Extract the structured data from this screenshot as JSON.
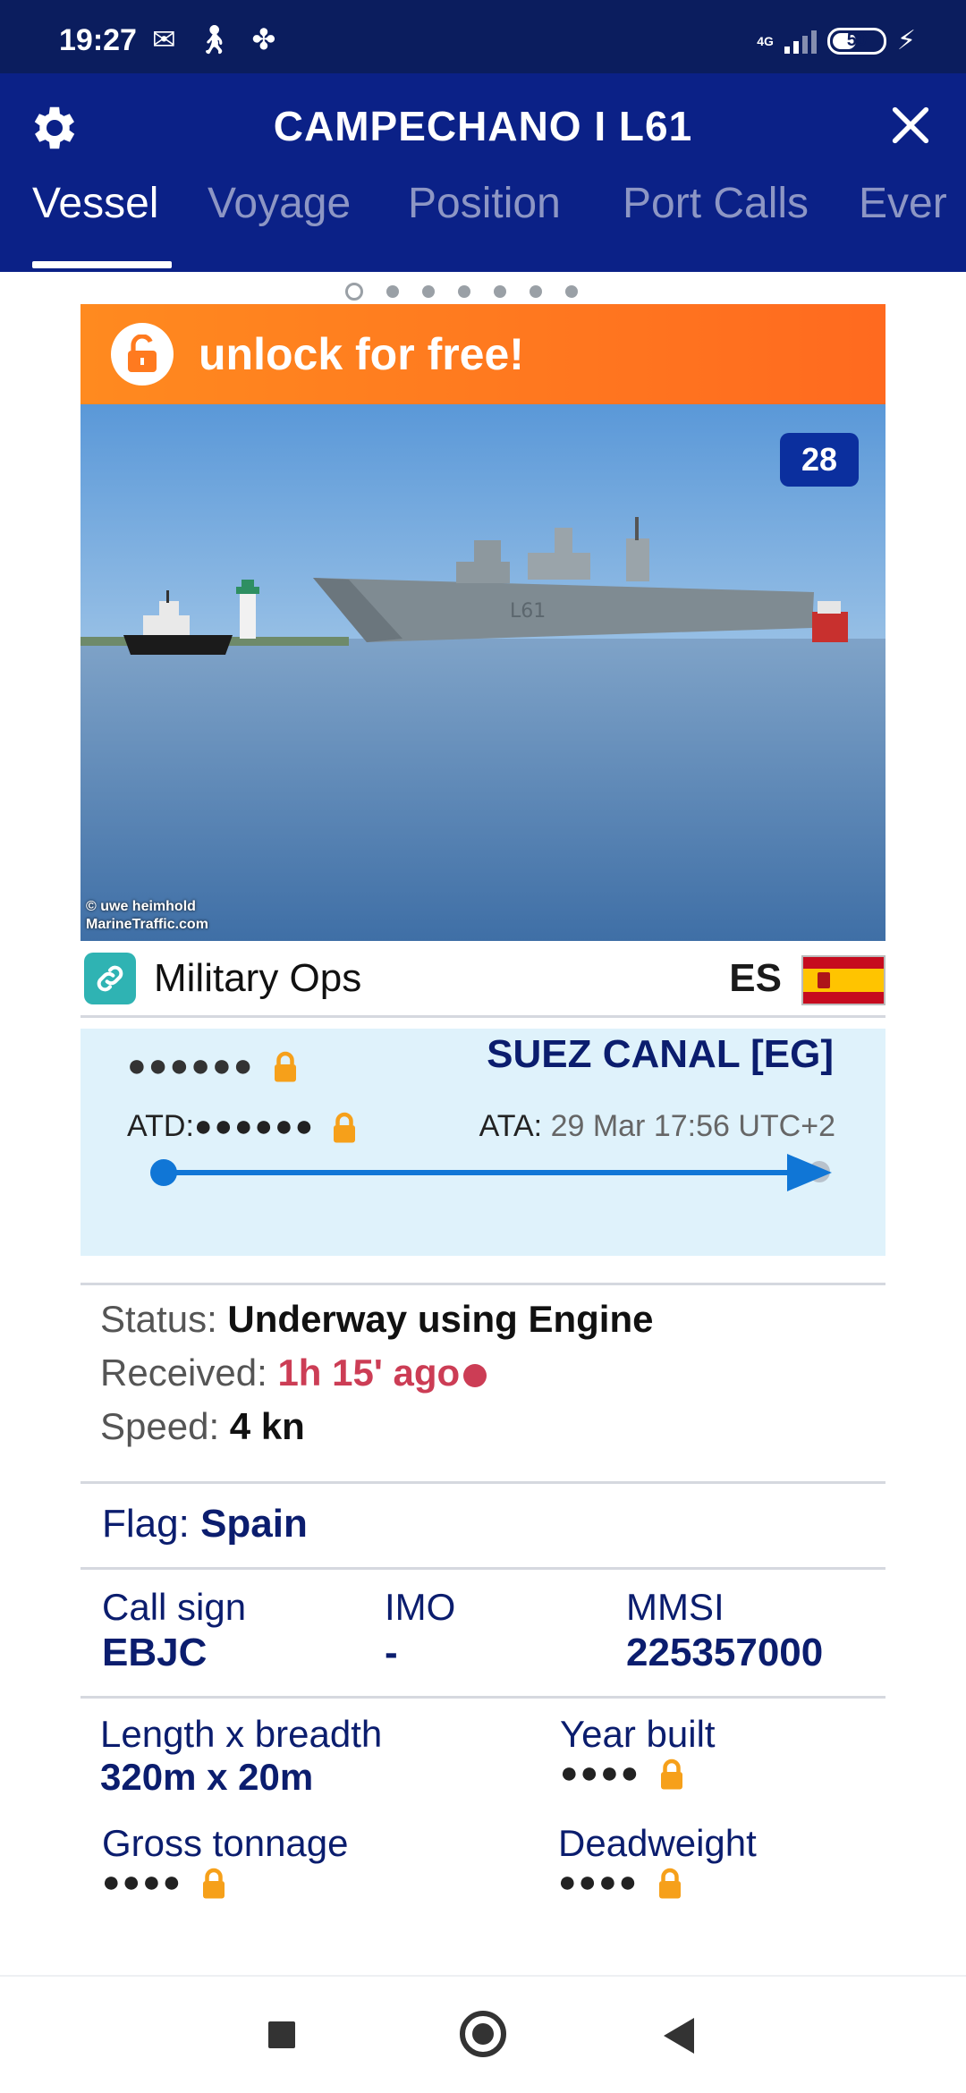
{
  "status_bar": {
    "time": "19:27",
    "network": "4G",
    "battery": "50"
  },
  "header": {
    "title": "CAMPECHANO I L61",
    "tabs": [
      {
        "label": "Vessel",
        "active": true
      },
      {
        "label": "Voyage",
        "active": false
      },
      {
        "label": "Position",
        "active": false
      },
      {
        "label": "Port Calls",
        "active": false
      },
      {
        "label": "Ever",
        "active": false
      }
    ]
  },
  "pager": {
    "count": 7,
    "active_index": 0
  },
  "unlock": {
    "label": "unlock for free!"
  },
  "photo": {
    "count": "28",
    "credit_line1": "© uwe heimhold",
    "credit_line2": "MarineTraffic.com"
  },
  "vessel_type": {
    "label": "Military Ops",
    "country_code": "ES"
  },
  "voyage": {
    "origin_masked": "●●●●●●",
    "destination": "SUEZ CANAL [EG]",
    "atd_label": "ATD:",
    "atd_masked": "●●●●●●",
    "ata_label": "ATA:",
    "ata_value": "29 Mar 17:56 UTC+2"
  },
  "status": {
    "status_label": "Status:",
    "status_value": "Underway using Engine",
    "received_label": "Received:",
    "received_value": "1h 15' ago",
    "speed_label": "Speed:",
    "speed_value": "4 kn"
  },
  "flag": {
    "label": "Flag:",
    "value": "Spain"
  },
  "ids": {
    "callsign_label": "Call sign",
    "callsign_value": "EBJC",
    "imo_label": "IMO",
    "imo_value": "-",
    "mmsi_label": "MMSI",
    "mmsi_value": "225357000"
  },
  "dimensions": {
    "length_label": "Length x breadth",
    "length_value": "320m x 20m",
    "year_label": "Year built",
    "year_masked": "●●●●",
    "gross_label": "Gross tonnage",
    "gross_masked": "●●●●",
    "dwt_label": "Deadweight",
    "dwt_masked": "●●●●"
  },
  "colors": {
    "header_bg": "#0b2187",
    "status_bar_bg": "#0b1d5e",
    "accent_orange": "#ff7a1f",
    "lock_orange": "#f6a01a",
    "navy_text": "#0b1d6e",
    "received_red": "#cc3d55",
    "voyage_bg": "#dff2fb"
  },
  "icons": [
    "message-icon",
    "walk-icon",
    "fan-icon",
    "signal-icon",
    "battery-icon",
    "charging-icon",
    "gear-icon",
    "close-icon",
    "lock-icon",
    "link-icon",
    "flag-spain-icon"
  ]
}
